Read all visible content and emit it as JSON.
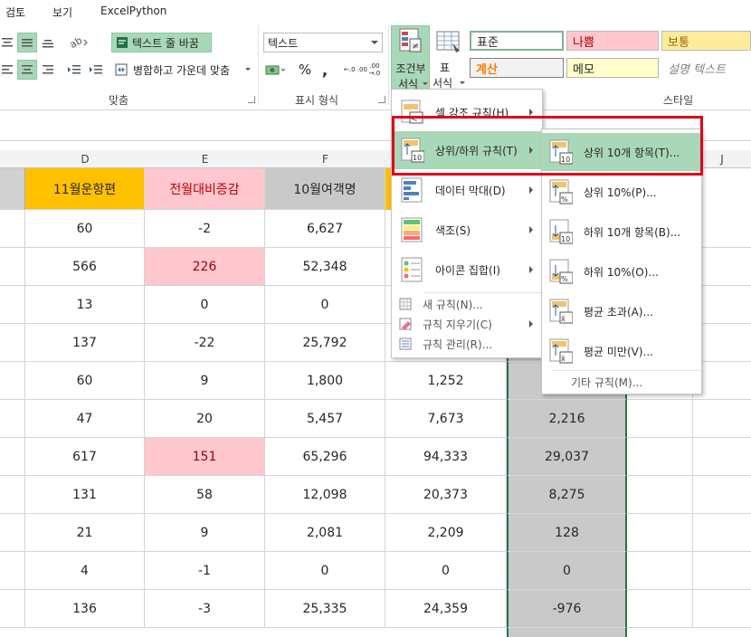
{
  "menubar": {
    "items": [
      "검토",
      "보기",
      "ExcelPython"
    ]
  },
  "ribbon": {
    "alignment": {
      "wrap_text": "텍스트 줄 바꿈",
      "merge_center": "병합하고 가운데 맞춤",
      "group_label": "맞춤"
    },
    "number": {
      "format_value": "텍스트",
      "percent": "%",
      "comma": ",",
      "increase_decimal": "←.0 .00",
      "decrease_decimal": ".00 →.0",
      "group_label": "표시 형식"
    },
    "conditional_format": {
      "line1": "조건부",
      "line2": "서식"
    },
    "table_format": {
      "line1": "표",
      "line2": "서식"
    },
    "styles": {
      "normal": "표준",
      "bad": "나쁨",
      "neutral": "보통",
      "calculation": "계산",
      "note": "메모",
      "explanatory": "설명 텍스트",
      "group_label": "스타일"
    }
  },
  "columns": [
    "D",
    "E",
    "F",
    "J"
  ],
  "headers": {
    "d": "11월운항편",
    "e": "전월대비증감",
    "f": "10월여객명"
  },
  "rows": [
    {
      "d": "60",
      "e": "-2",
      "f": "6,627",
      "g": "",
      "h": ""
    },
    {
      "d": "566",
      "e": "226",
      "f": "52,348",
      "g": "",
      "h": ""
    },
    {
      "d": "13",
      "e": "0",
      "f": "0",
      "g": "",
      "h": ""
    },
    {
      "d": "137",
      "e": "-22",
      "f": "25,792",
      "g": "",
      "h": ""
    },
    {
      "d": "60",
      "e": "9",
      "f": "1,800",
      "g": "1,252",
      "h": ""
    },
    {
      "d": "47",
      "e": "20",
      "f": "5,457",
      "g": "7,673",
      "h": "2,216"
    },
    {
      "d": "617",
      "e": "151",
      "f": "65,296",
      "g": "94,333",
      "h": "29,037"
    },
    {
      "d": "131",
      "e": "58",
      "f": "12,098",
      "g": "20,373",
      "h": "8,275"
    },
    {
      "d": "21",
      "e": "9",
      "f": "2,081",
      "g": "2,209",
      "h": "128"
    },
    {
      "d": "4",
      "e": "-1",
      "f": "0",
      "g": "0",
      "h": "0"
    },
    {
      "d": "136",
      "e": "-3",
      "f": "25,335",
      "g": "24,359",
      "h": "-976"
    }
  ],
  "cf_menu": {
    "items": [
      {
        "label": "셀 강조 규칙(H)"
      },
      {
        "label": "상위/하위 규칙(T)"
      },
      {
        "label": "데이터 막대(D)"
      },
      {
        "label": "색조(S)"
      },
      {
        "label": "아이콘 집합(I)"
      }
    ],
    "small_items": [
      {
        "label": "새 규칙(N)..."
      },
      {
        "label": "규칙 지우기(C)"
      },
      {
        "label": "규칙 관리(R)..."
      }
    ]
  },
  "sub_menu": {
    "items": [
      {
        "label": "상위 10개 항목(T)..."
      },
      {
        "label": "상위 10%(P)..."
      },
      {
        "label": "하위 10개 항목(B)..."
      },
      {
        "label": "하위 10%(O)..."
      },
      {
        "label": "평균 초과(A)..."
      },
      {
        "label": "평균 미만(V)..."
      }
    ],
    "more": "기타 규칙(M)..."
  },
  "colors": {
    "accent_green": "#a9d8b8",
    "header_orange": "#ffc000",
    "header_pink": "#ffc7ce",
    "header_gray": "#c9c9c9",
    "highlight_red": "#e0001b",
    "dark_red_text": "#9c0006"
  }
}
